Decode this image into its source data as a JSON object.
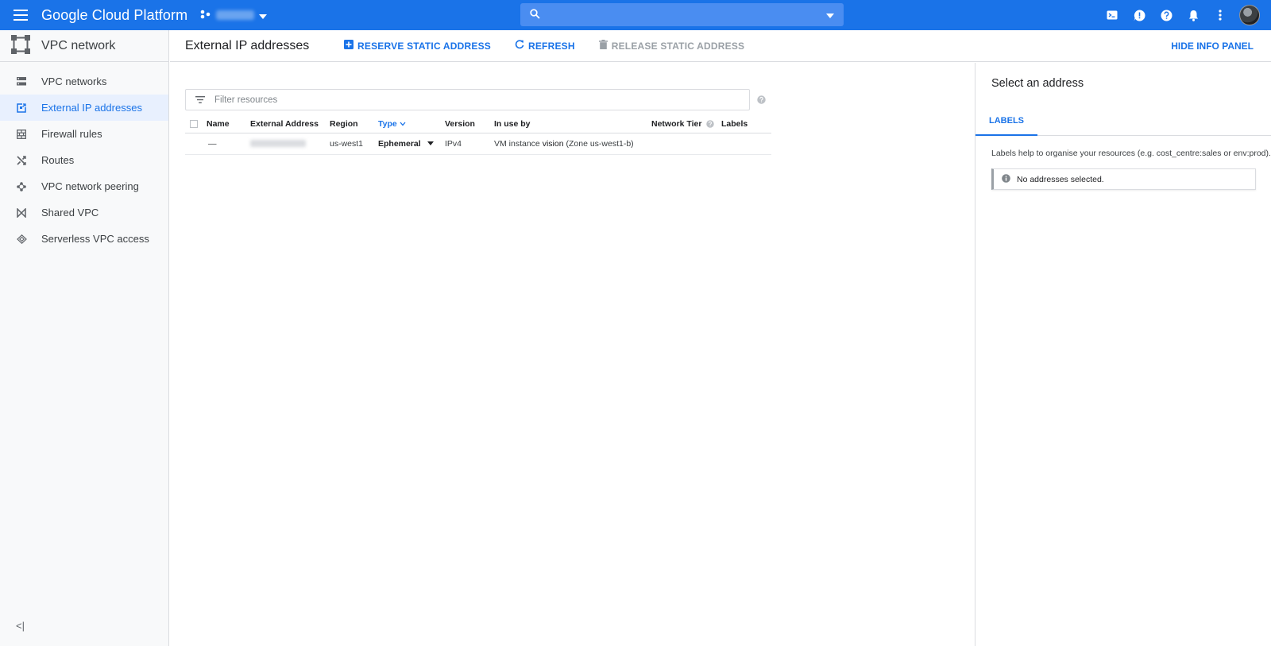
{
  "topbar": {
    "brand": "Google Cloud Platform",
    "project_icon": "project-dots-icon",
    "search_placeholder": "",
    "icons": [
      "cloud-shell-icon",
      "feedback-icon",
      "help-icon",
      "notifications-icon",
      "more-vert-icon"
    ],
    "color": "#1a73e8"
  },
  "sidenav": {
    "product": "VPC network",
    "items": [
      {
        "label": "VPC networks",
        "icon": "vpc-networks-icon",
        "active": false
      },
      {
        "label": "External IP addresses",
        "icon": "external-ip-icon",
        "active": true
      },
      {
        "label": "Firewall rules",
        "icon": "firewall-icon",
        "active": false
      },
      {
        "label": "Routes",
        "icon": "routes-icon",
        "active": false
      },
      {
        "label": "VPC network peering",
        "icon": "peering-icon",
        "active": false
      },
      {
        "label": "Shared VPC",
        "icon": "shared-vpc-icon",
        "active": false
      },
      {
        "label": "Serverless VPC access",
        "icon": "serverless-icon",
        "active": false
      }
    ],
    "collapse_label": "<|"
  },
  "header": {
    "title": "External IP addresses",
    "reserve_label": "RESERVE STATIC ADDRESS",
    "refresh_label": "REFRESH",
    "release_label": "RELEASE STATIC ADDRESS",
    "hide_info_label": "HIDE INFO PANEL"
  },
  "filter": {
    "placeholder": "Filter resources"
  },
  "table": {
    "columns": [
      "Name",
      "External Address",
      "Region",
      "Type",
      "Version",
      "In use by",
      "Network Tier",
      "Labels"
    ],
    "rows": [
      {
        "name": "—",
        "external_address": "",
        "region": "us-west1",
        "type": "Ephemeral",
        "version": "IPv4",
        "in_use_prefix": "VM instance ",
        "in_use_name": "vision",
        "in_use_suffix": " (Zone us-west1-b)",
        "network_tier": "",
        "labels": ""
      }
    ]
  },
  "info_panel": {
    "heading": "Select an address",
    "tab_label": "LABELS",
    "description": "Labels help to organise your resources (e.g. cost_centre:sales or env:prod).",
    "notice": "No addresses selected."
  }
}
